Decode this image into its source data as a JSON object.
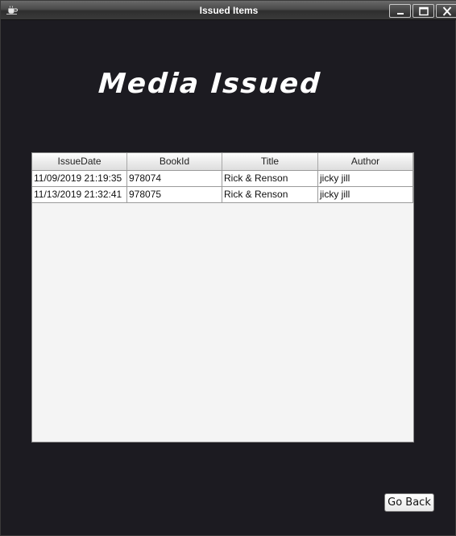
{
  "window": {
    "title": "Issued Items"
  },
  "heading": "Media Issued",
  "table": {
    "columns": [
      "IssueDate",
      "BookId",
      "Title",
      "Author"
    ],
    "rows": [
      [
        "11/09/2019 21:19:35",
        "978074",
        "Rick & Renson",
        "jicky jill"
      ],
      [
        "11/13/2019 21:32:41",
        "978075",
        "Rick & Renson",
        "jicky jill"
      ]
    ]
  },
  "buttons": {
    "go_back": "Go Back"
  },
  "colors": {
    "background": "#1c1b21",
    "heading_text": "#ffffff",
    "table_background": "#f4f4f4"
  }
}
